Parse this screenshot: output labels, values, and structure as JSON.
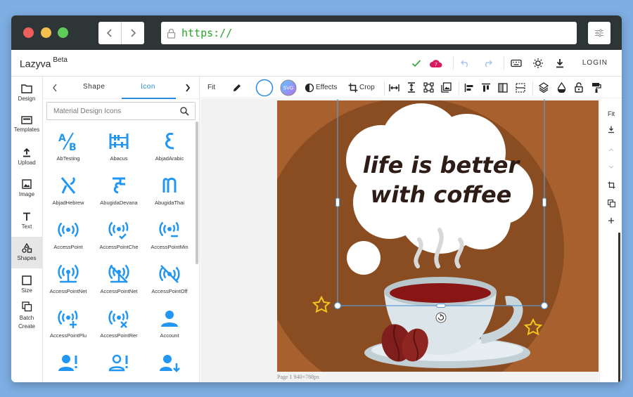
{
  "browser": {
    "url": "https://",
    "traffic_lights": {
      "close": "#ed5f5a",
      "minimize": "#f4bf4f",
      "maximize": "#5fcc5a"
    }
  },
  "app": {
    "name": "Lazyva",
    "badge": "Beta",
    "notification_count": "7",
    "login_label": "LOGIN",
    "accent": "#2a8adf"
  },
  "leftnav": [
    {
      "label": "Design",
      "icon": "folder-icon"
    },
    {
      "label": "Templates",
      "icon": "templates-icon"
    },
    {
      "label": "Upload",
      "icon": "upload-icon"
    },
    {
      "label": "Image",
      "icon": "image-icon"
    },
    {
      "label": "Text",
      "icon": "text-icon"
    },
    {
      "label": "Shapes",
      "icon": "shapes-icon"
    },
    {
      "label": "Size",
      "icon": "size-icon"
    },
    {
      "label": "Batch Create",
      "icon": "batch-create-icon"
    }
  ],
  "panel": {
    "tabs": [
      "Shape",
      "Icon"
    ],
    "active_tab": "Icon",
    "search_placeholder": "Material Design Icons",
    "icons": [
      "AbTesting",
      "Abacus",
      "AbjadArabic",
      "AbjadHebrew",
      "AbugidaDevana",
      "AbugidaThai",
      "AccessPoint",
      "AccessPointChe",
      "AccessPointMin",
      "AccessPointNet",
      "AccessPointNet",
      "AccessPointOff",
      "AccessPointPlu",
      "AccessPointRer",
      "Account",
      "",
      "",
      ""
    ]
  },
  "toolbar": {
    "fit": "Fit",
    "svg_badge": "SVG",
    "effects": "Effects",
    "crop": "Crop"
  },
  "canvas": {
    "quote_line1": "life is better",
    "quote_line2": "with coffee",
    "page_label": "Page 1 940×788px",
    "background": "#a8612e"
  },
  "rightbar": {
    "fit": "Fit"
  }
}
